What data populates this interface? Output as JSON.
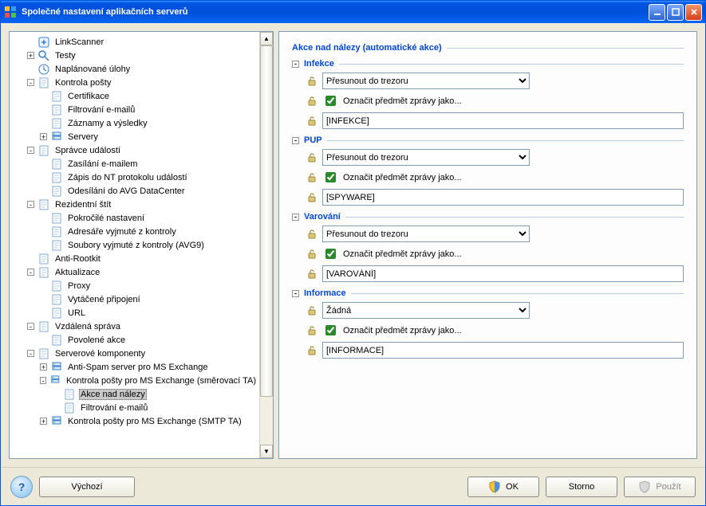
{
  "window": {
    "title": "Společné nastavení aplikačních serverů"
  },
  "tree": {
    "items": [
      {
        "lvl": 1,
        "exp": "",
        "icon": "link",
        "label": "LinkScanner"
      },
      {
        "lvl": 1,
        "exp": "+",
        "icon": "glass",
        "label": "Testy"
      },
      {
        "lvl": 1,
        "exp": "",
        "icon": "sched",
        "label": "Naplánované úlohy"
      },
      {
        "lvl": 1,
        "exp": "-",
        "icon": "page",
        "label": "Kontrola pošty"
      },
      {
        "lvl": 2,
        "exp": "",
        "icon": "page",
        "label": "Certifikace"
      },
      {
        "lvl": 2,
        "exp": "",
        "icon": "page",
        "label": "Filtrování e-mailů"
      },
      {
        "lvl": 2,
        "exp": "",
        "icon": "page",
        "label": "Záznamy a výsledky"
      },
      {
        "lvl": 2,
        "exp": "+",
        "icon": "server",
        "label": "Servery"
      },
      {
        "lvl": 1,
        "exp": "-",
        "icon": "page",
        "label": "Správce událostí"
      },
      {
        "lvl": 2,
        "exp": "",
        "icon": "page",
        "label": "Zasílání e-mailem"
      },
      {
        "lvl": 2,
        "exp": "",
        "icon": "page",
        "label": "Zápis do NT protokolu událostí"
      },
      {
        "lvl": 2,
        "exp": "",
        "icon": "page",
        "label": "Odesílání do AVG DataCenter"
      },
      {
        "lvl": 1,
        "exp": "-",
        "icon": "page",
        "label": "Rezidentní štít"
      },
      {
        "lvl": 2,
        "exp": "",
        "icon": "page",
        "label": "Pokročilé nastavení"
      },
      {
        "lvl": 2,
        "exp": "",
        "icon": "page",
        "label": "Adresáře vyjmuté z kontroly"
      },
      {
        "lvl": 2,
        "exp": "",
        "icon": "page",
        "label": "Soubory vyjmuté z kontroly (AVG9)"
      },
      {
        "lvl": 1,
        "exp": "",
        "icon": "page",
        "label": "Anti-Rootkit"
      },
      {
        "lvl": 1,
        "exp": "-",
        "icon": "page",
        "label": "Aktualizace"
      },
      {
        "lvl": 2,
        "exp": "",
        "icon": "page",
        "label": "Proxy"
      },
      {
        "lvl": 2,
        "exp": "",
        "icon": "page",
        "label": "Vytáčené připojení"
      },
      {
        "lvl": 2,
        "exp": "",
        "icon": "page",
        "label": "URL"
      },
      {
        "lvl": 1,
        "exp": "-",
        "icon": "page",
        "label": "Vzdálená správa"
      },
      {
        "lvl": 2,
        "exp": "",
        "icon": "page",
        "label": "Povolené akce"
      },
      {
        "lvl": 1,
        "exp": "-",
        "icon": "page",
        "label": "Serverové komponenty"
      },
      {
        "lvl": 2,
        "exp": "+",
        "icon": "server",
        "label": "Anti-Spam server pro MS Exchange"
      },
      {
        "lvl": 2,
        "exp": "-",
        "icon": "server",
        "label": "Kontrola pošty pro MS Exchange (směrovací TA)"
      },
      {
        "lvl": 3,
        "exp": "",
        "icon": "page",
        "label": "Akce nad nálezy",
        "selected": true
      },
      {
        "lvl": 3,
        "exp": "",
        "icon": "page",
        "label": "Filtrování e-mailů"
      },
      {
        "lvl": 2,
        "exp": "+",
        "icon": "server",
        "label": "Kontrola pošty pro MS Exchange (SMTP TA)"
      }
    ]
  },
  "panel": {
    "heading": "Akce nad nálezy (automatické akce)",
    "groups": [
      {
        "title": "Infekce",
        "action": "Přesunout do trezoru",
        "mark": "Označit předmět zprávy jako...",
        "tag": "[INFEKCE]"
      },
      {
        "title": "PUP",
        "action": "Přesunout do trezoru",
        "mark": "Označit předmět zprávy jako...",
        "tag": "[SPYWARE]"
      },
      {
        "title": "Varování",
        "action": "Přesunout do trezoru",
        "mark": "Označit předmět zprávy jako...",
        "tag": "[VAROVÁNÍ]"
      },
      {
        "title": "Informace",
        "action": "Žádná",
        "mark": "Označit předmět zprávy jako...",
        "tag": "[INFORMACE]"
      }
    ]
  },
  "buttons": {
    "default_": "Výchozí",
    "ok": "OK",
    "cancel": "Storno",
    "apply": "Použít",
    "help": "?"
  }
}
